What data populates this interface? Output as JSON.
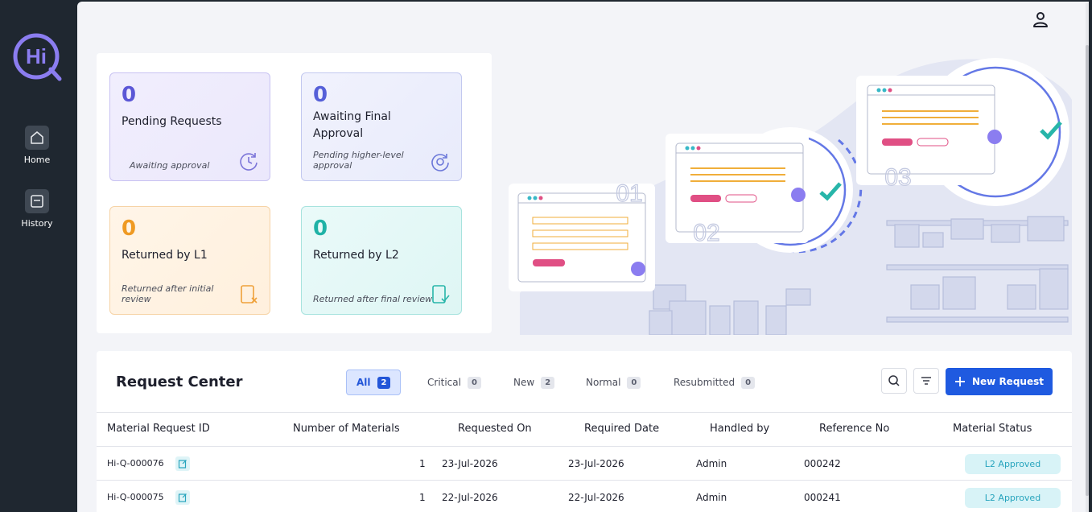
{
  "sidebar": {
    "logo_text": "Hi",
    "items": [
      {
        "label": "Home",
        "icon": "home-icon"
      },
      {
        "label": "History",
        "icon": "history-icon"
      }
    ]
  },
  "header": {
    "user_icon": "user-icon"
  },
  "stats": [
    {
      "count": "0",
      "title": "Pending Requests",
      "subtitle": "Awaiting approval",
      "icon": "clock-refresh-icon"
    },
    {
      "count": "0",
      "title": "Awaiting Final Approval",
      "subtitle": "Pending higher-level approval",
      "icon": "refresh-icon"
    },
    {
      "count": "0",
      "title": "Returned by L1",
      "subtitle": "Returned after initial review",
      "icon": "document-x-icon"
    },
    {
      "count": "0",
      "title": "Returned by L2",
      "subtitle": "Returned after final review",
      "icon": "document-check-icon"
    }
  ],
  "illustration": {
    "steps": [
      "01",
      "02",
      "03"
    ]
  },
  "request_center": {
    "title": "Request Center",
    "tabs": [
      {
        "label": "All",
        "count": "2"
      },
      {
        "label": "Critical",
        "count": "0"
      },
      {
        "label": "New",
        "count": "2"
      },
      {
        "label": "Normal",
        "count": "0"
      },
      {
        "label": "Resubmitted",
        "count": "0"
      }
    ],
    "new_request_label": "New Request",
    "columns": [
      "Material Request ID",
      "Number of Materials",
      "Requested On",
      "Required Date",
      "Handled by",
      "Reference No",
      "Material Status"
    ],
    "rows": [
      {
        "id": "Hi-Q-000076",
        "materials": "1",
        "requested_on": "23-Jul-2026",
        "required_date": "23-Jul-2026",
        "handled_by": "Admin",
        "reference": "000242",
        "status": "L2 Approved"
      },
      {
        "id": "Hi-Q-000075",
        "materials": "1",
        "requested_on": "22-Jul-2026",
        "required_date": "22-Jul-2026",
        "handled_by": "Admin",
        "reference": "000241",
        "status": "L2 Approved"
      }
    ]
  }
}
